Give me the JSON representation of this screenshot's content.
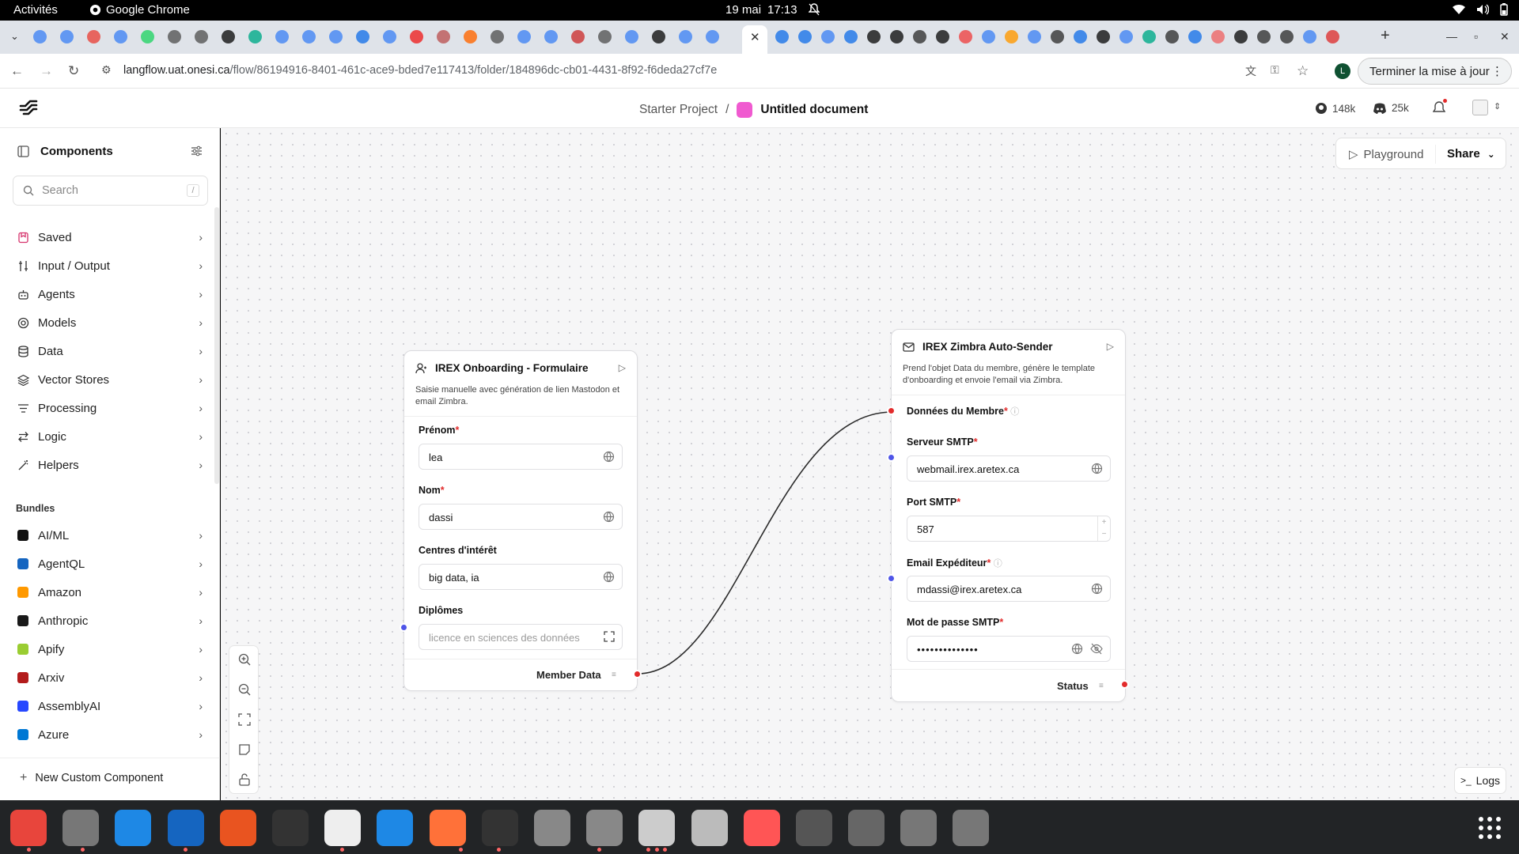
{
  "system_bar": {
    "activities": "Activités",
    "app_name": "Google Chrome",
    "date": "19 mai",
    "time": "17:13"
  },
  "browser": {
    "url_host": "langflow.uat.onesi.ca",
    "url_path": "/flow/86194916-8401-461c-ace9-bded7e117413/folder/184896dc-cb01-4431-8f92-f6deda27cf7e",
    "profile_letter": "L",
    "update_button": "Terminer la mise à jour"
  },
  "header": {
    "project": "Starter Project",
    "separator": "/",
    "document": "Untitled document",
    "github_stars": "148k",
    "discord_members": "25k"
  },
  "sidebar": {
    "title": "Components",
    "search_placeholder": "Search",
    "search_shortcut": "/",
    "items": [
      {
        "label": "Saved",
        "icon": "bookmark-icon"
      },
      {
        "label": "Input / Output",
        "icon": "io-icon"
      },
      {
        "label": "Agents",
        "icon": "bot-icon"
      },
      {
        "label": "Models",
        "icon": "brain-icon"
      },
      {
        "label": "Data",
        "icon": "database-icon"
      },
      {
        "label": "Vector Stores",
        "icon": "layers-icon"
      },
      {
        "label": "Processing",
        "icon": "filter-icon"
      },
      {
        "label": "Logic",
        "icon": "arrows-icon"
      },
      {
        "label": "Helpers",
        "icon": "wand-icon"
      }
    ],
    "bundles_title": "Bundles",
    "bundles": [
      {
        "label": "AI/ML"
      },
      {
        "label": "AgentQL"
      },
      {
        "label": "Amazon"
      },
      {
        "label": "Anthropic"
      },
      {
        "label": "Apify"
      },
      {
        "label": "Arxiv"
      },
      {
        "label": "AssemblyAI"
      },
      {
        "label": "Azure"
      }
    ],
    "new_custom": "New Custom Component"
  },
  "toolbar": {
    "playground": "Playground",
    "share": "Share",
    "logs": "Logs"
  },
  "node_form": {
    "title": "IREX Onboarding - Formulaire",
    "description": "Saisie manuelle avec génération de lien Mastodon et email Zimbra.",
    "fields": [
      {
        "label": "Prénom",
        "required": "*",
        "value": "lea"
      },
      {
        "label": "Nom",
        "required": "*",
        "value": "dassi"
      },
      {
        "label": "Centres d'intérêt",
        "required": "",
        "value": "big data, ia"
      },
      {
        "label": "Diplômes",
        "required": "",
        "value": "licence en sciences des données"
      }
    ],
    "output": "Member Data"
  },
  "node_sender": {
    "title": "IREX Zimbra Auto-Sender",
    "description": "Prend l'objet Data du membre, génère le template d'onboarding et envoie l'email via Zimbra.",
    "member_label": "Données du Membre",
    "req": "*",
    "fields": [
      {
        "label": "Serveur SMTP",
        "value": "webmail.irex.aretex.ca"
      },
      {
        "label": "Port SMTP",
        "value": "587"
      },
      {
        "label": "Email Expéditeur",
        "value": "mdassi@irex.aretex.ca"
      },
      {
        "label": "Mot de passe SMTP",
        "value": "••••••••••••••"
      }
    ],
    "output": "Status"
  },
  "colors": {
    "accent_red": "#e22b2b",
    "handle_blue": "#4f55e8",
    "edge": "#2b2b2b"
  }
}
